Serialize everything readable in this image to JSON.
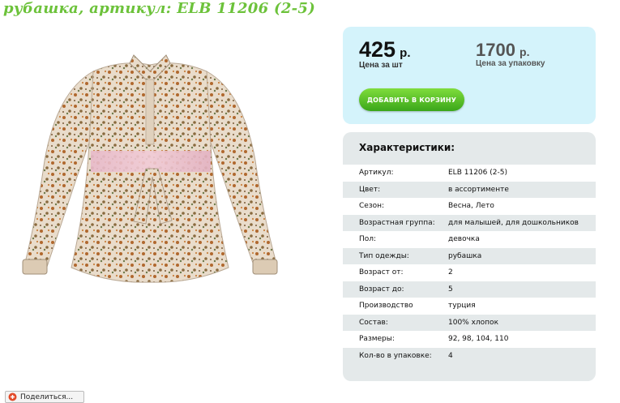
{
  "product": {
    "title": "рубашка, артикул: ELB 11206 (2-5)"
  },
  "price": {
    "unit_value": "425",
    "unit_currency": "р.",
    "unit_caption": "Цена за шт",
    "pack_value": "1700",
    "pack_currency": "р.",
    "pack_caption": "Цена за упаковку",
    "add_to_cart_label": "ДОБАВИТЬ В КОРЗИНУ"
  },
  "specs": {
    "heading": "Характеристики:",
    "rows": [
      {
        "key": "Артикул:",
        "value": "ELB 11206 (2-5)"
      },
      {
        "key": "Цвет:",
        "value": "в ассортименте"
      },
      {
        "key": "Сезон:",
        "value": "Весна, Лето"
      },
      {
        "key": "Возрастная группа:",
        "value": "для малышей, для дошкольников"
      },
      {
        "key": "Пол:",
        "value": "девочка"
      },
      {
        "key": "Тип одежды:",
        "value": "рубашка"
      },
      {
        "key": "Возраст от:",
        "value": "2"
      },
      {
        "key": "Возраст до:",
        "value": "5"
      },
      {
        "key": "Производство",
        "value": "турция"
      },
      {
        "key": "Состав:",
        "value": "100% хлопок"
      },
      {
        "key": "Размеры:",
        "value": "92, 98, 104, 110"
      },
      {
        "key": "Кол-во в упаковке:",
        "value": "4"
      }
    ]
  },
  "share": {
    "label": "Поделиться..."
  },
  "colors": {
    "title_green": "#6cc23a",
    "price_box_bg": "#d4f3fb",
    "spec_box_bg": "#e4e9ea",
    "button_green": "#4cb824"
  }
}
